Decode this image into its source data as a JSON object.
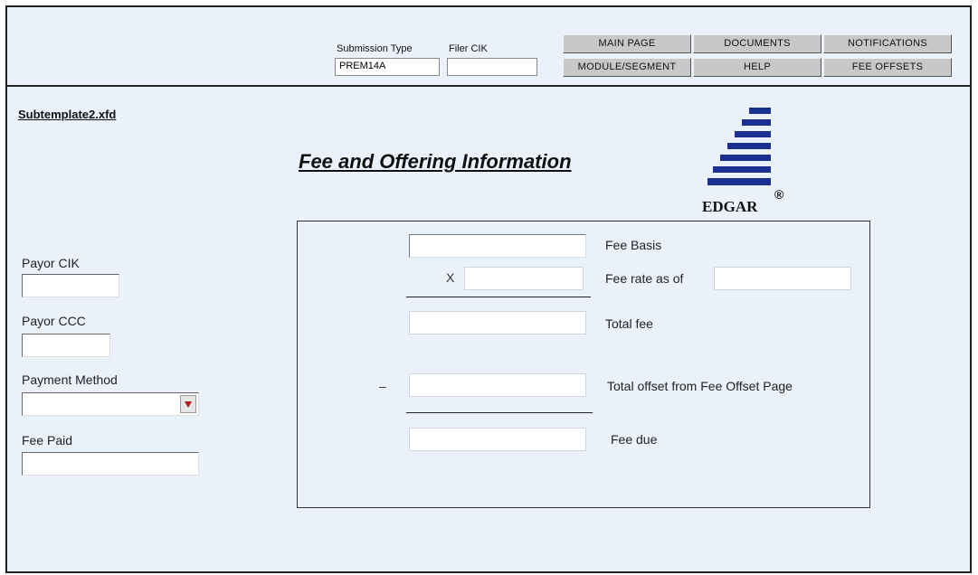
{
  "header": {
    "submission_type_label": "Submission Type",
    "submission_type_value": "PREM14A",
    "filer_cik_label": "Filer CIK",
    "filer_cik_value": "",
    "nav": {
      "main_page": "MAIN PAGE",
      "documents": "DOCUMENTS",
      "notifications": "NOTIFICATIONS",
      "module_segment": "MODULE/SEGMENT",
      "help": "HELP",
      "fee_offsets": "FEE OFFSETS"
    }
  },
  "document_name": "Subtemplate2.xfd",
  "page_title": "Fee and Offering Information",
  "logo": {
    "text": "EDGAR",
    "mark": "®",
    "color": "#1a2f8f"
  },
  "left_form": {
    "payor_cik_label": "Payor CIK",
    "payor_ccc_label": "Payor CCC",
    "payment_method_label": "Payment Method",
    "payment_method_value": "",
    "fee_paid_label": "Fee Paid"
  },
  "fee_panel": {
    "fee_basis_label": "Fee Basis",
    "multiply_symbol": "X",
    "fee_rate_label": "Fee rate as of",
    "total_fee_label": "Total fee",
    "minus_symbol": "–",
    "total_offset_label": "Total offset from Fee Offset Page",
    "fee_due_label": "Fee due"
  },
  "colors": {
    "background": "#eaf1fb",
    "button": "#c8c8c8",
    "dropdown_arrow": "#b01818"
  }
}
